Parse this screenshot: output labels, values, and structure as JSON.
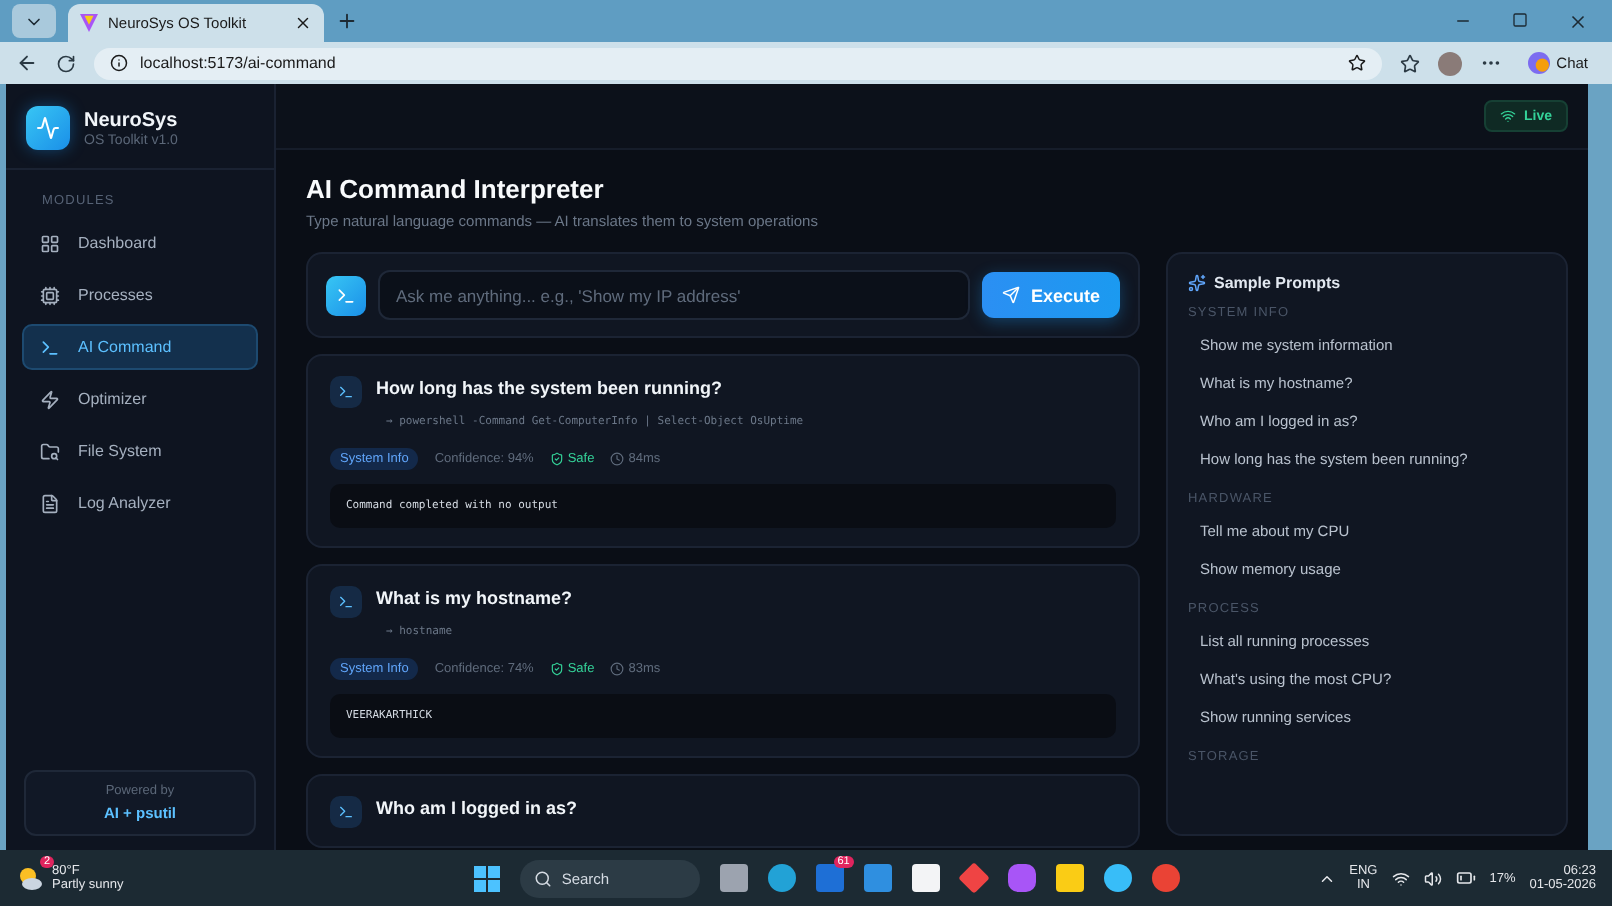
{
  "browser": {
    "tab_title": "NeuroSys OS Toolkit",
    "url": "localhost:5173/ai-command",
    "chat": "Chat"
  },
  "sidebar": {
    "brand": "NeuroSys",
    "version": "OS Toolkit v1.0",
    "section_label": "MODULES",
    "items": [
      {
        "label": "Dashboard",
        "selected": false
      },
      {
        "label": "Processes",
        "selected": false
      },
      {
        "label": "AI Command",
        "selected": true
      },
      {
        "label": "Optimizer",
        "selected": false
      },
      {
        "label": "File System",
        "selected": false
      },
      {
        "label": "Log Analyzer",
        "selected": false
      }
    ],
    "powered_by": "Powered by",
    "powered_by_value": "AI + psutil"
  },
  "header": {
    "status": "Live"
  },
  "page": {
    "title": "AI Command Interpreter",
    "subtitle": "Type natural language commands — AI translates them to system operations"
  },
  "command": {
    "placeholder": "Ask me anything... e.g., 'Show my IP address'",
    "button": "Execute"
  },
  "history": [
    {
      "query": "How long has the system been running?",
      "command": "→ powershell -Command Get-ComputerInfo | Select-Object OsUptime",
      "category": "System Info",
      "confidence": "Confidence: 94%",
      "safe": true,
      "safe_label": "Safe",
      "time": "84ms",
      "output": "Command completed with no output"
    },
    {
      "query": "What is my hostname?",
      "command": "→ hostname",
      "category": "System Info",
      "confidence": "Confidence: 74%",
      "safe": true,
      "safe_label": "Safe",
      "time": "83ms",
      "output": "VEERAKARTHICK"
    },
    {
      "query": "Who am I logged in as?"
    }
  ],
  "samples": {
    "title": "Sample Prompts",
    "groups": [
      {
        "label": "SYSTEM INFO",
        "items": [
          "Show me system information",
          "What is my hostname?",
          "Who am I logged in as?",
          "How long has the system been running?"
        ]
      },
      {
        "label": "HARDWARE",
        "items": [
          "Tell me about my CPU",
          "Show memory usage"
        ]
      },
      {
        "label": "PROCESS",
        "items": [
          "List all running processes",
          "What's using the most CPU?",
          "Show running services"
        ]
      },
      {
        "label": "STORAGE"
      }
    ]
  },
  "taskbar": {
    "weather_badge": "2",
    "temperature": "80°F",
    "weather": "Partly sunny",
    "search": "Search",
    "app_badge": "61",
    "language": "ENG",
    "region": "IN",
    "battery": "17%",
    "time": "06:23",
    "date": "01-05-2026"
  }
}
